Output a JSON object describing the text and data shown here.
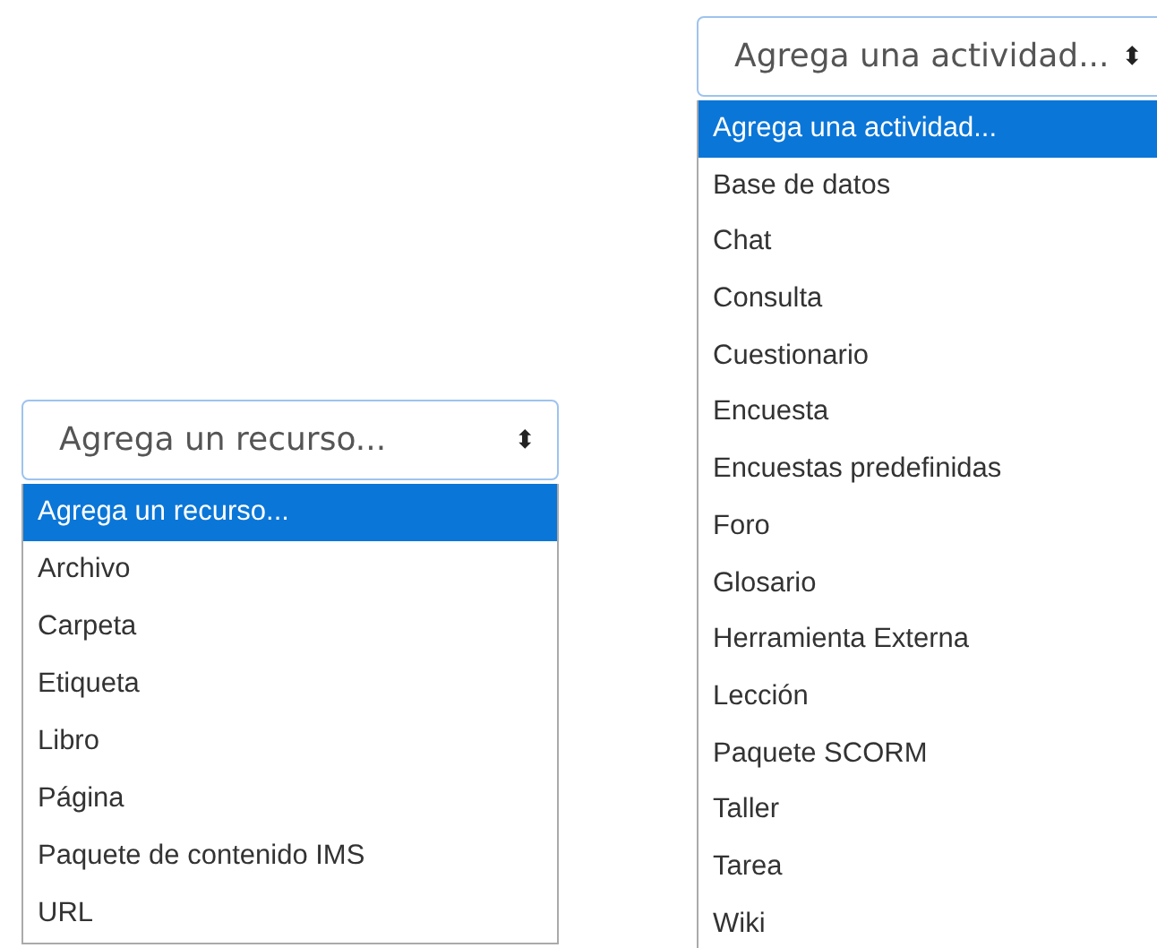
{
  "dropdowns": [
    {
      "value": "Agrega un recurso...",
      "caret": "⬍",
      "options": [
        {
          "label": "Agrega un recurso...",
          "selected": true
        },
        {
          "label": "Archivo",
          "selected": false
        },
        {
          "label": "Carpeta",
          "selected": false
        },
        {
          "label": "Etiqueta",
          "selected": false
        },
        {
          "label": "Libro",
          "selected": false
        },
        {
          "label": "Página",
          "selected": false
        },
        {
          "label": "Paquete de contenido IMS",
          "selected": false
        },
        {
          "label": "URL",
          "selected": false
        }
      ]
    },
    {
      "value": "Agrega una actividad...",
      "caret": "⬍",
      "options": [
        {
          "label": "Agrega una actividad...",
          "selected": true
        },
        {
          "label": "Base de datos",
          "selected": false
        },
        {
          "label": "Chat",
          "selected": false
        },
        {
          "label": "Consulta",
          "selected": false
        },
        {
          "label": "Cuestionario",
          "selected": false
        },
        {
          "label": "Encuesta",
          "selected": false
        },
        {
          "label": "Encuestas predefinidas",
          "selected": false
        },
        {
          "label": "Foro",
          "selected": false
        },
        {
          "label": "Glosario",
          "selected": false
        },
        {
          "label": "Herramienta Externa",
          "selected": false
        },
        {
          "label": "Lección",
          "selected": false
        },
        {
          "label": "Paquete SCORM",
          "selected": false
        },
        {
          "label": "Taller",
          "selected": false
        },
        {
          "label": "Tarea",
          "selected": false
        },
        {
          "label": "Wiki",
          "selected": false
        }
      ]
    }
  ]
}
